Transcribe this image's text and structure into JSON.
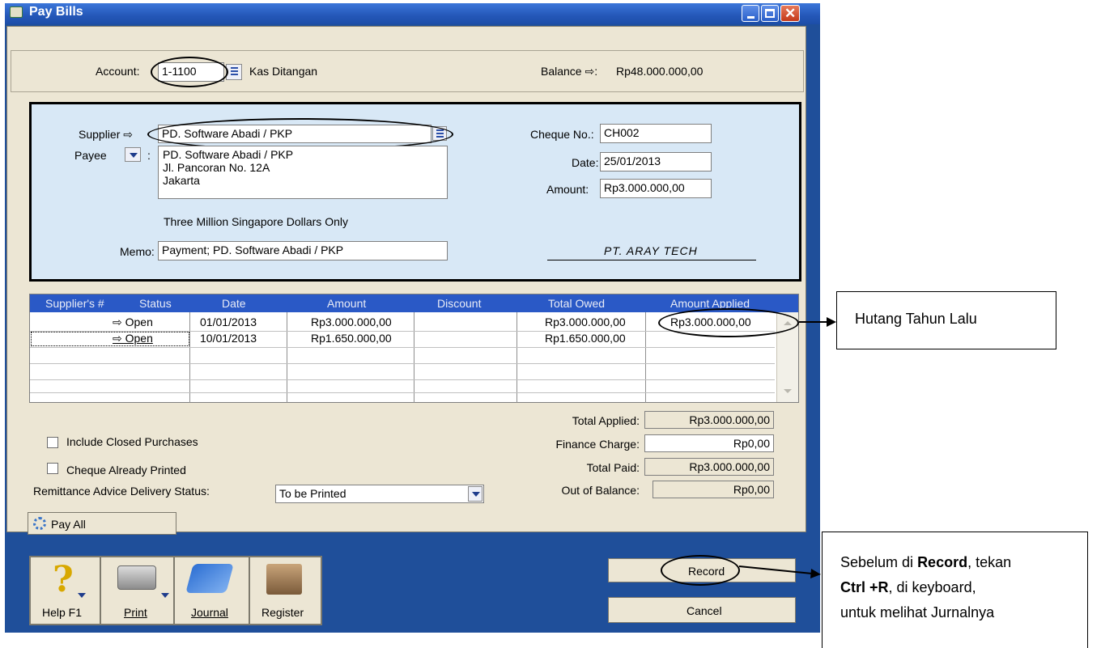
{
  "window": {
    "title": "Pay Bills"
  },
  "account": {
    "label": "Account:",
    "value": "1-1100",
    "name": "Kas Ditangan",
    "balance_label": "Balance ⇨:",
    "balance_value": "Rp48.000.000,00"
  },
  "cheque": {
    "supplier_label": "Supplier ⇨",
    "supplier_value": "PD. Software Abadi / PKP",
    "payee_label": ":",
    "payee_title": "Payee",
    "payee_lines": [
      "PD. Software Abadi / PKP",
      "Jl. Pancoran No. 12A",
      "Jakarta"
    ],
    "amount_words": "Three Million Singapore Dollars Only",
    "memo_label": "Memo:",
    "memo_value": "Payment; PD. Software Abadi / PKP",
    "cheque_no_label": "Cheque No.:",
    "cheque_no_value": "CH002",
    "date_label": "Date:",
    "date_value": "25/01/2013",
    "amount_label": "Amount:",
    "amount_value": "Rp3.000.000,00",
    "signature": "PT. ARAY TECH"
  },
  "grid": {
    "headers": [
      "Supplier's #",
      "Status",
      "Date",
      "Amount",
      "Discount",
      "Total Owed",
      "Amount Applied"
    ],
    "rows": [
      {
        "status": "⇨ Open",
        "date": "01/01/2013",
        "amount": "Rp3.000.000,00",
        "discount": "",
        "total_owed": "Rp3.000.000,00",
        "applied": "Rp3.000.000,00"
      },
      {
        "status": "⇨ Open",
        "date": "10/01/2013",
        "amount": "Rp1.650.000,00",
        "discount": "",
        "total_owed": "Rp1.650.000,00",
        "applied": ""
      }
    ]
  },
  "totals": {
    "applied_label": "Total Applied:",
    "applied_value": "Rp3.000.000,00",
    "finance_label": "Finance Charge:",
    "finance_value": "Rp0,00",
    "paid_label": "Total Paid:",
    "paid_value": "Rp3.000.000,00",
    "oob_label": "Out of Balance:",
    "oob_value": "Rp0,00"
  },
  "options": {
    "include_closed": "Include Closed Purchases",
    "cheque_printed": "Cheque Already Printed",
    "remit_label": "Remittance Advice Delivery Status:",
    "remit_value": "To be Printed",
    "pay_all": "Pay All"
  },
  "toolbar": {
    "help": "Help F1",
    "print": "Print",
    "journal": "Journal",
    "register": "Register"
  },
  "actions": {
    "record": "Record",
    "cancel": "Cancel"
  },
  "annotations": {
    "hutang": "Hutang Tahun Lalu",
    "note_pre": "Sebelum di ",
    "note_b1": "Record",
    "note_mid": ", tekan",
    "note_b2": "Ctrl +R",
    "note_mid2": ", di keyboard,",
    "note_end": "untuk melihat Jurnalnya"
  },
  "colors": {
    "window_blue": "#1f4f9a",
    "panel": "#ece6d4",
    "cheque_bg": "#d8e8f6",
    "grid_header": "#2a59c6"
  }
}
